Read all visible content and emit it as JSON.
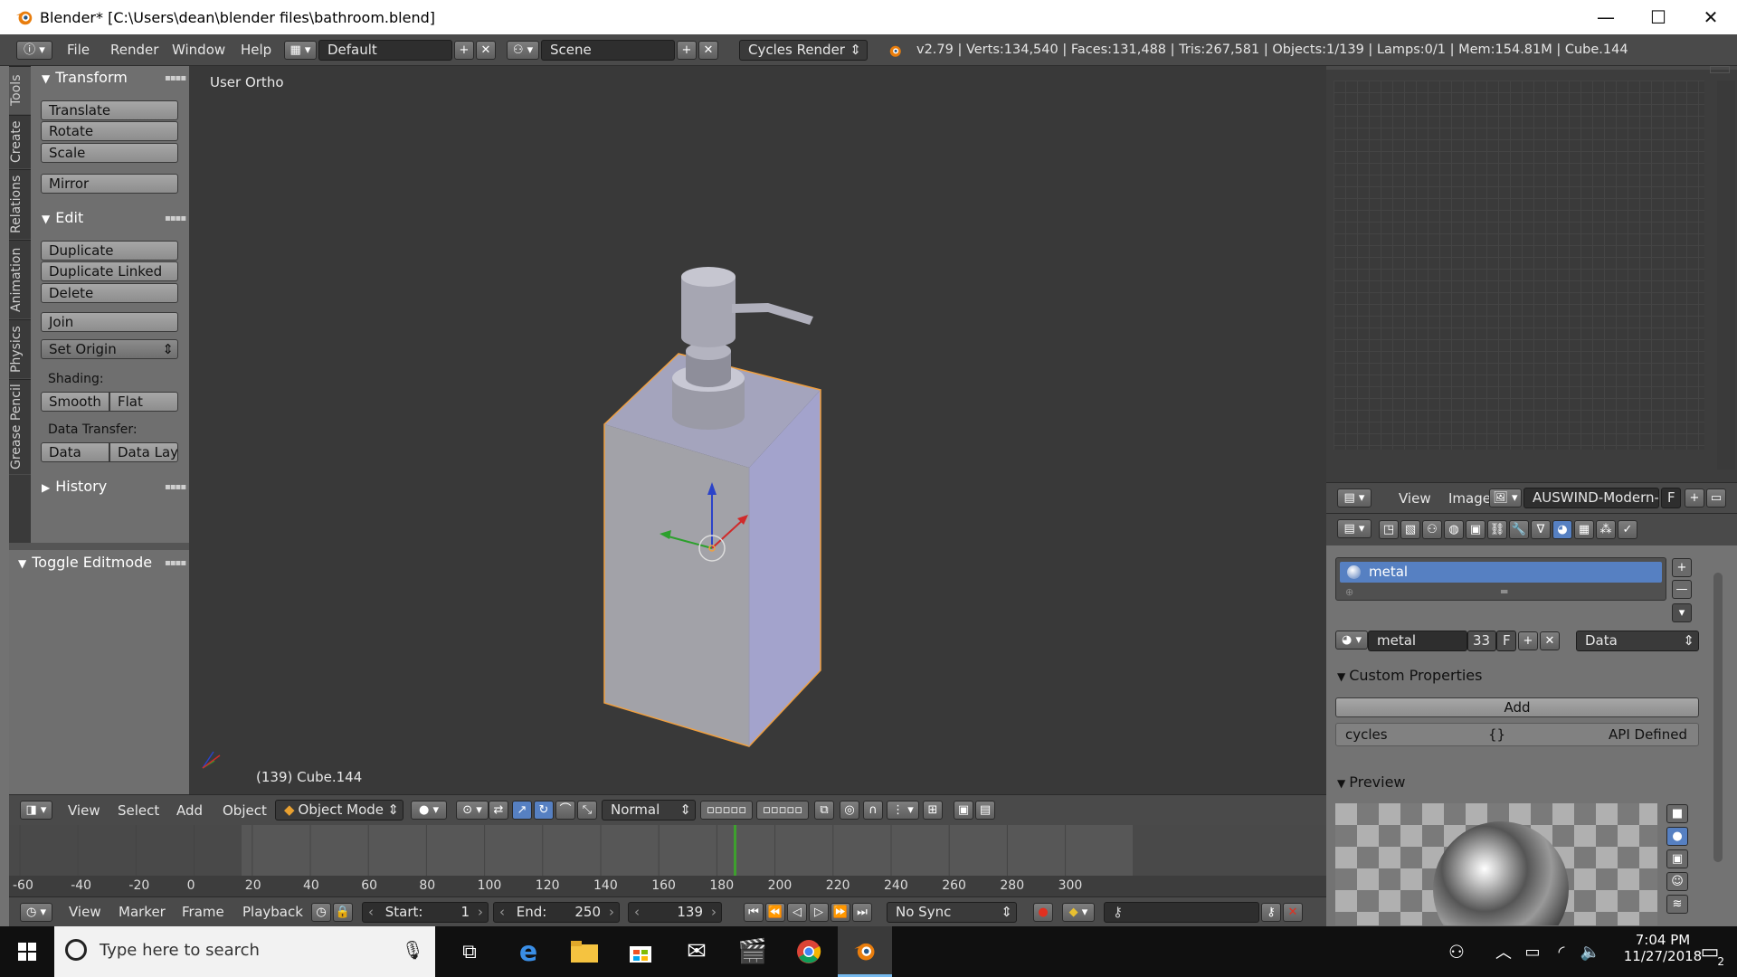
{
  "window": {
    "title": "Blender* [C:\\Users\\dean\\blender files\\bathroom.blend]",
    "controls": [
      "—",
      "☐",
      "✕"
    ]
  },
  "main_header": {
    "menus": [
      "File",
      "Render",
      "Window",
      "Help"
    ],
    "screen_layout": "Default",
    "scene": "Scene",
    "render_engine": "Cycles Render",
    "stats": "v2.79 | Verts:134,540 | Faces:131,488 | Tris:267,581 | Objects:1/139 | Lamps:0/1 | Mem:154.81M | Cube.144"
  },
  "tool_tabs": [
    "Tools",
    "Create",
    "Relations",
    "Animation",
    "Physics",
    "Grease Pencil"
  ],
  "tool_shelf": {
    "transform": {
      "header": "Transform",
      "buttons": [
        "Translate",
        "Rotate",
        "Scale",
        "Mirror"
      ]
    },
    "edit": {
      "header": "Edit",
      "buttons": [
        "Duplicate",
        "Duplicate Linked",
        "Delete",
        "Join"
      ],
      "set_origin": "Set Origin",
      "shading_label": "Shading:",
      "shading_buttons": [
        "Smooth",
        "Flat"
      ],
      "data_transfer_label": "Data Transfer:",
      "data_transfer_buttons": [
        "Data",
        "Data Lay"
      ]
    },
    "history": "History",
    "operator": "Toggle Editmode"
  },
  "viewport": {
    "view_name": "User Ortho",
    "object_info": "(139) Cube.144"
  },
  "viewport_header": {
    "menus": [
      "View",
      "Select",
      "Add",
      "Object"
    ],
    "mode": "Object Mode",
    "orientation": "Normal"
  },
  "timeline": {
    "ruler_labels": [
      "-60",
      "-40",
      "-20",
      "0",
      "20",
      "40",
      "60",
      "80",
      "100",
      "120",
      "140",
      "160",
      "180",
      "200",
      "220",
      "240",
      "260",
      "280",
      "300"
    ],
    "current_frame": "139",
    "menus": [
      "View",
      "Marker",
      "Frame",
      "Playback"
    ],
    "start_label": "Start:",
    "start_value": "1",
    "end_label": "End:",
    "end_value": "250",
    "sync": "No Sync"
  },
  "image_editor_header": {
    "menus": [
      "View",
      "Image"
    ],
    "image_name": "AUSWIND-Modern-...",
    "fake_user": "F"
  },
  "properties": {
    "material_slot": "metal",
    "material_name": "metal",
    "users": "33",
    "fake_user": "F",
    "link": "Data",
    "custom_properties": {
      "header": "Custom Properties",
      "add_button": "Add",
      "row_name": "cycles",
      "row_value": "{}",
      "row_status": "API Defined"
    },
    "preview_header": "Preview"
  },
  "taskbar": {
    "search_placeholder": "Type here to search",
    "time": "7:04 PM",
    "date": "11/27/2018",
    "notifications": "2"
  },
  "colors": {
    "selected_outline": "#f0a040",
    "accent_blue": "#5680c2",
    "frame_marker": "#3ea02e"
  }
}
